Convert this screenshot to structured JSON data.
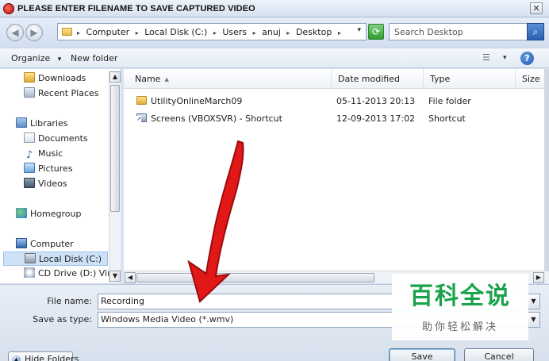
{
  "window": {
    "title": "PLEASE ENTER FILENAME TO SAVE CAPTURED VIDEO",
    "close_glyph": "✕"
  },
  "address": {
    "back_glyph": "◀",
    "forward_glyph": "▶",
    "breadcrumb": [
      "Computer",
      "Local Disk (C:)",
      "Users",
      "anuj",
      "Desktop"
    ],
    "separator": "▸",
    "dropdown_glyph": "▾",
    "refresh_glyph": "⟳",
    "search_placeholder": "Search Desktop",
    "search_glyph": "⌕"
  },
  "toolbar": {
    "organize_label": "Organize",
    "organize_caret": "▾",
    "new_folder_label": "New folder",
    "view_glyph": "☰",
    "view_caret": "▾",
    "help_glyph": "?"
  },
  "nav_pane": {
    "items": [
      {
        "label": "Downloads",
        "icon": "downloads-folder-icon"
      },
      {
        "label": "Recent Places",
        "icon": "recent-places-icon"
      },
      {
        "label": "Libraries",
        "icon": "libraries-icon"
      },
      {
        "label": "Documents",
        "icon": "documents-icon"
      },
      {
        "label": "Music",
        "icon": "music-icon"
      },
      {
        "label": "Pictures",
        "icon": "pictures-icon"
      },
      {
        "label": "Videos",
        "icon": "videos-icon"
      },
      {
        "label": "Homegroup",
        "icon": "homegroup-icon"
      },
      {
        "label": "Computer",
        "icon": "computer-icon"
      },
      {
        "label": "Local Disk (C:)",
        "icon": "local-disk-icon",
        "selected": true
      },
      {
        "label": "CD Drive (D:) VirtualBox",
        "icon": "cd-drive-icon"
      }
    ],
    "music_glyph": "♪"
  },
  "file_list": {
    "columns": [
      "Name",
      "Date modified",
      "Type",
      "Size"
    ],
    "sort_glyph": "▲",
    "rows": [
      {
        "name": "UtilityOnlineMarch09",
        "date": "05-11-2013 20:13",
        "type": "File folder",
        "icon": "folder-icon"
      },
      {
        "name": "Screens (VBOXSVR) - Shortcut",
        "date": "12-09-2013 17:02",
        "type": "Shortcut",
        "icon": "shortcut-icon"
      }
    ]
  },
  "scroll": {
    "up_glyph": "▲",
    "down_glyph": "▼",
    "left_glyph": "◀",
    "right_glyph": "▶"
  },
  "form": {
    "file_name_label": "File name:",
    "file_name_value": "Recording",
    "save_type_label": "Save as type:",
    "save_type_value": "Windows Media Video (*.wmv)",
    "dropdown_glyph": "▼"
  },
  "buttons": {
    "hide_folders": "Hide Folders",
    "hide_glyph": "▲",
    "save": "Save",
    "cancel": "Cancel"
  },
  "watermark": {
    "title": "百科全说",
    "subtitle": "助你轻松解决"
  },
  "colors": {
    "annotation_arrow": "#e01818",
    "watermark_green": "#1aa34a"
  }
}
